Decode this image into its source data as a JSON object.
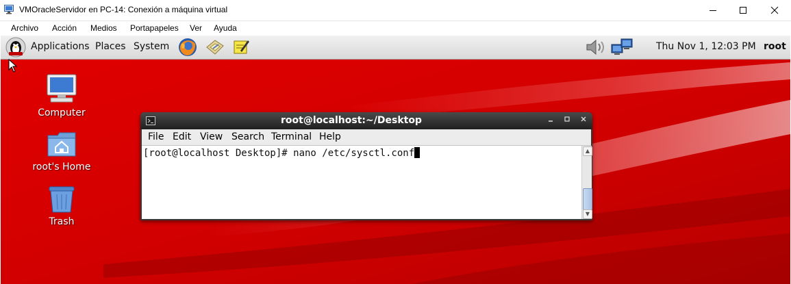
{
  "host_window": {
    "title": "VMOracleServidor en PC-14: Conexión a máquina virtual",
    "menu": [
      "Archivo",
      "Acción",
      "Medios",
      "Portapapeles",
      "Ver",
      "Ayuda"
    ]
  },
  "panel": {
    "menus": [
      "Applications",
      "Places",
      "System"
    ],
    "clock": "Thu Nov  1, 12:03 PM",
    "user": "root"
  },
  "desktop": {
    "icons": [
      "Computer",
      "root's Home",
      "Trash"
    ]
  },
  "terminal": {
    "title": "root@localhost:~/Desktop",
    "menu": [
      "File",
      "Edit",
      "View",
      "Search",
      "Terminal",
      "Help"
    ],
    "line": "[root@localhost Desktop]# nano /etc/sysctl.conf"
  },
  "colors": {
    "desktop_red": "#d80000",
    "panel_bg": "#e4e4e4",
    "terminal_titlebar": "#2e2e2e"
  }
}
